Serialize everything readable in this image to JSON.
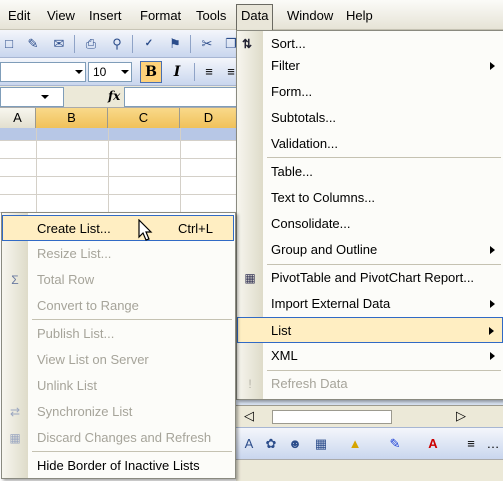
{
  "menubar": {
    "items": [
      "Edit",
      "View",
      "Insert",
      "Format",
      "Tools",
      "Data",
      "Window",
      "Help"
    ],
    "open_item": "Data"
  },
  "toolbar": {
    "font_size": "10",
    "bold_label": "B",
    "italic_label": "I"
  },
  "formula_bar": {
    "fx_label": "fx"
  },
  "columns": [
    "A",
    "B",
    "C",
    "D"
  ],
  "data_menu": {
    "items": [
      {
        "label": "Sort...",
        "submenu": false
      },
      {
        "label": "Filter",
        "submenu": true
      },
      {
        "label": "Form...",
        "submenu": false
      },
      {
        "label": "Subtotals...",
        "submenu": false
      },
      {
        "label": "Validation...",
        "submenu": false
      },
      {
        "label": "Table...",
        "submenu": false
      },
      {
        "label": "Text to Columns...",
        "submenu": false
      },
      {
        "label": "Consolidate...",
        "submenu": false
      },
      {
        "label": "Group and Outline",
        "submenu": true
      },
      {
        "label": "PivotTable and PivotChart Report...",
        "submenu": false
      },
      {
        "label": "Import External Data",
        "submenu": true
      },
      {
        "label": "List",
        "submenu": true
      },
      {
        "label": "XML",
        "submenu": true
      },
      {
        "label": "Refresh Data",
        "submenu": false,
        "disabled": true
      }
    ]
  },
  "list_submenu": {
    "items": [
      {
        "label": "Create List...",
        "shortcut": "Ctrl+L",
        "highlight": true
      },
      {
        "label": "Resize List...",
        "disabled": true
      },
      {
        "label": "Total Row",
        "disabled": true
      },
      {
        "label": "Convert to Range",
        "disabled": true
      },
      {
        "label": "Publish List...",
        "disabled": true
      },
      {
        "label": "View List on Server",
        "disabled": true
      },
      {
        "label": "Unlink List",
        "disabled": true
      },
      {
        "label": "Synchronize List",
        "disabled": true
      },
      {
        "label": "Discard Changes and Refresh",
        "disabled": true
      },
      {
        "label": "Hide Border of Inactive Lists",
        "disabled": false
      }
    ]
  },
  "colors": {
    "highlight_bg": "#ffeec2",
    "highlight_border": "#316ac5",
    "disabled_text": "#a6a49a",
    "toolbar_blue": "#c9d6ee"
  }
}
